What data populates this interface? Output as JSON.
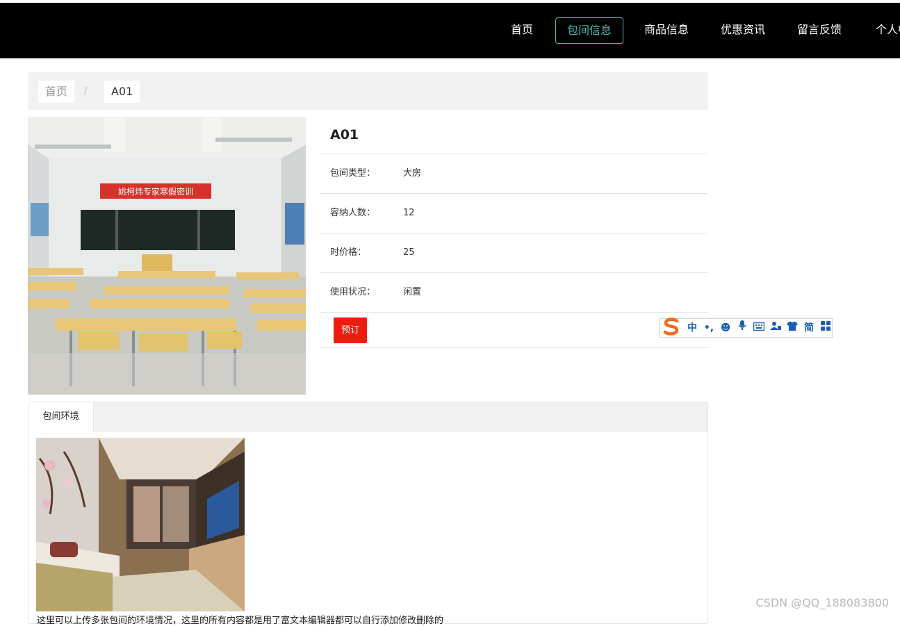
{
  "nav": {
    "items": [
      {
        "label": "首页",
        "active": false
      },
      {
        "label": "包间信息",
        "active": true
      },
      {
        "label": "商品信息",
        "active": false
      },
      {
        "label": "优惠资讯",
        "active": false
      },
      {
        "label": "留言反馈",
        "active": false
      },
      {
        "label": "个人中",
        "active": false
      }
    ],
    "accent_color": "#4fb8b0"
  },
  "breadcrumb": {
    "home": "首页",
    "separator": "/",
    "current": "A01"
  },
  "room": {
    "banner": "姚柯炜专家寒假密训",
    "title": "A01",
    "fields": [
      {
        "label": "包间类型：",
        "value": "大房"
      },
      {
        "label": "容纳人数：",
        "value": "12"
      },
      {
        "label": "时价格：",
        "value": "25"
      },
      {
        "label": "使用状况：",
        "value": "闲置"
      }
    ],
    "book_label": "预订",
    "book_color": "#ee1c0e"
  },
  "tabs": {
    "items": [
      {
        "label": "包间环境"
      }
    ],
    "description": "这里可以上传多张包间的环境情况，这里的所有内容都是用了富文本编辑器都可以自行添加修改删除的"
  },
  "ime": {
    "icons": [
      "sogou-logo-icon",
      "chinese-mode-icon",
      "punctuation-icon",
      "emoji-icon",
      "microphone-icon",
      "keyboard-icon",
      "user-icon",
      "skin-icon",
      "simplified-icon",
      "apps-icon"
    ],
    "labels": {
      "chinese": "中",
      "simplified": "简"
    }
  },
  "watermark": "CSDN @QQ_188083800"
}
